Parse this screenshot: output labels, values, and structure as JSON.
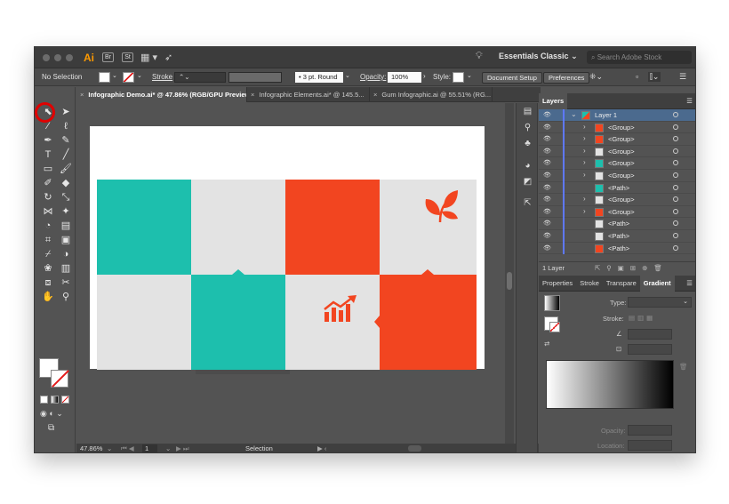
{
  "titlebar": {
    "app_logo": "Ai",
    "btn_br": "Br",
    "btn_st": "St",
    "workspace": "Essentials Classic",
    "stock_search_placeholder": "Search Adobe Stock"
  },
  "controlbar": {
    "selection_label": "No Selection",
    "stroke_label": "Stroke",
    "brush_profile": "3 pt. Round",
    "opacity_label": "Opacity:",
    "opacity_value": "100%",
    "style_label": "Style:",
    "document_setup": "Document Setup",
    "preferences": "Preferences"
  },
  "tabs": [
    {
      "label": "Infographic Demo.ai* @ 47.86% (RGB/GPU Preview)"
    },
    {
      "label": "Infographic Elements.ai* @ 145.5..."
    },
    {
      "label": "Gum Infographic.ai @ 55.51% (RG..."
    }
  ],
  "statusbar": {
    "zoom": "47.86%",
    "artboard_number": "1",
    "tool_name": "Selection"
  },
  "layers": {
    "tab": "Layers",
    "top_layer": "Layer 1",
    "rows": [
      {
        "name": "<Group>",
        "thumb": "#f24520",
        "arrow": "›"
      },
      {
        "name": "<Group>",
        "thumb": "#f24520",
        "arrow": "›"
      },
      {
        "name": "<Group>",
        "thumb": "#e3e3e3",
        "arrow": "›"
      },
      {
        "name": "<Group>",
        "thumb": "#1dbfad",
        "arrow": "›"
      },
      {
        "name": "<Group>",
        "thumb": "#e3e3e3",
        "arrow": "›"
      },
      {
        "name": "<Path>",
        "thumb": "#1dbfad",
        "arrow": ""
      },
      {
        "name": "<Group>",
        "thumb": "#e3e3e3",
        "arrow": "›"
      },
      {
        "name": "<Group>",
        "thumb": "#f24520",
        "arrow": "›"
      },
      {
        "name": "<Path>",
        "thumb": "#e3e3e3",
        "arrow": ""
      },
      {
        "name": "<Path>",
        "thumb": "#e3e3e3",
        "arrow": ""
      },
      {
        "name": "<Path>",
        "thumb": "#f24520",
        "arrow": ""
      }
    ],
    "footer": "1 Layer"
  },
  "gradient_panel": {
    "tabs": [
      "Properties",
      "Stroke",
      "Transpare",
      "Gradient"
    ],
    "type_label": "Type:",
    "stroke_label": "Stroke:",
    "opacity_label": "Opacity:",
    "location_label": "Location:"
  },
  "colors": {
    "teal": "#1dbfad",
    "orange": "#f24520",
    "grey": "#e3e3e3",
    "selection_highlight": "#e00000"
  }
}
